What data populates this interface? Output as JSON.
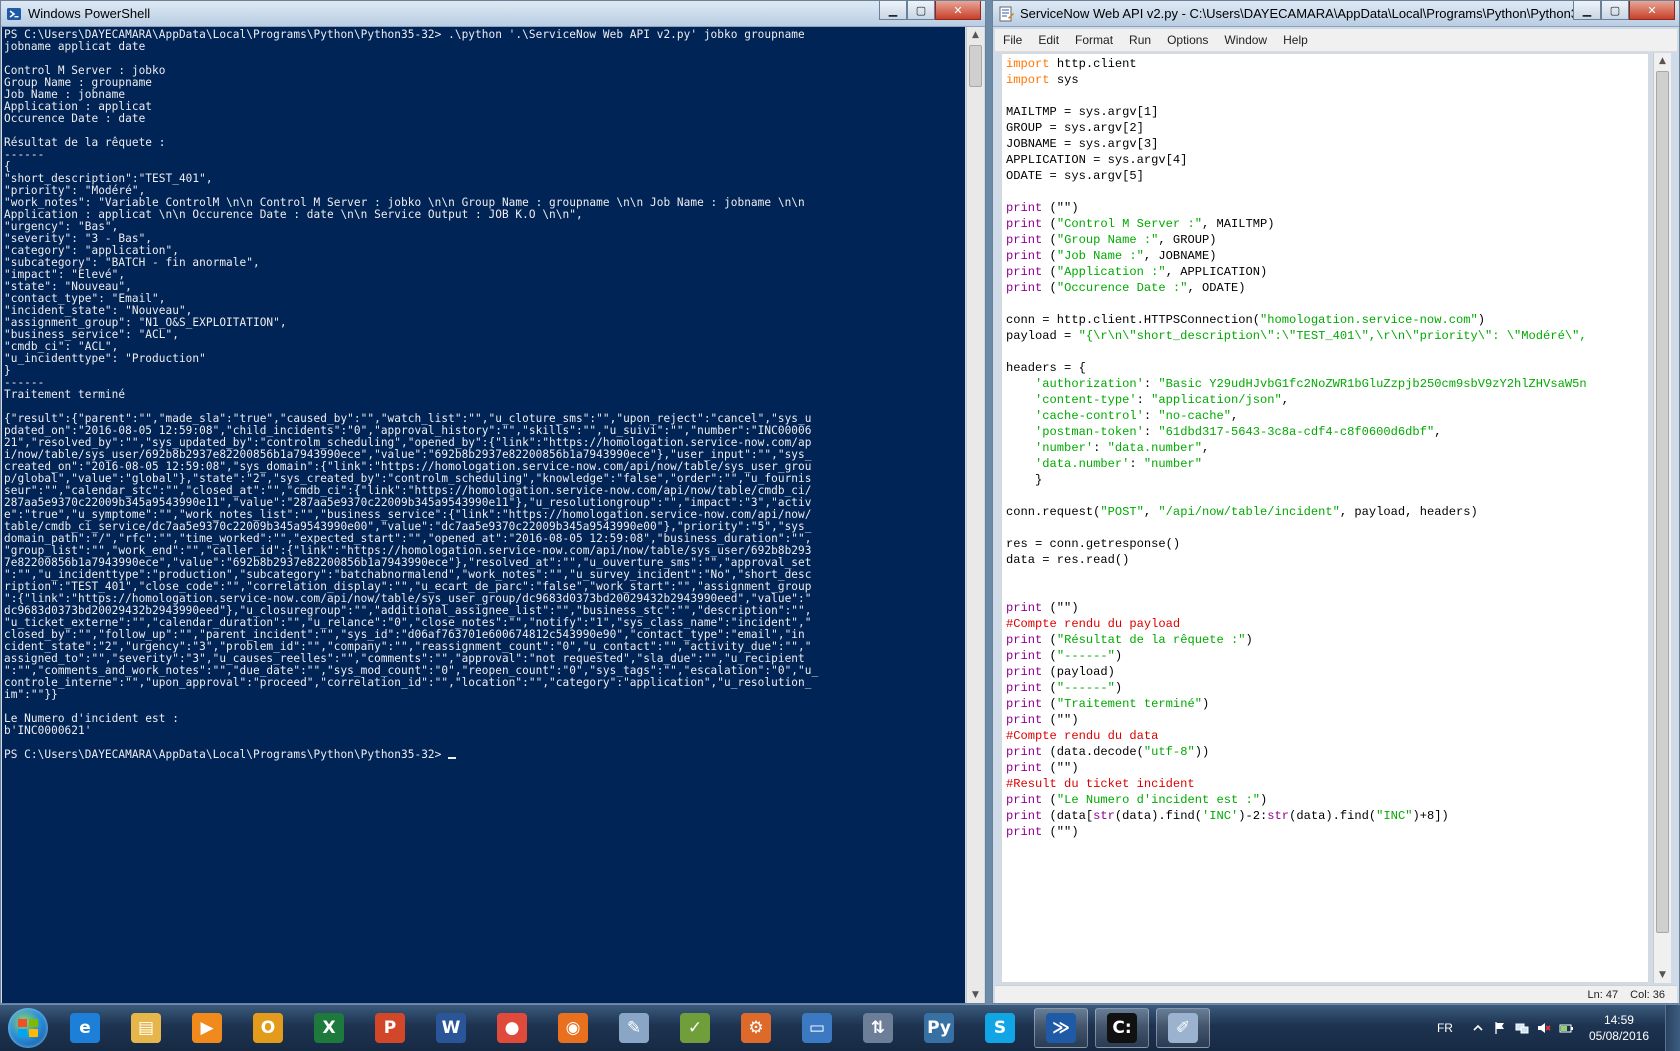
{
  "powershell": {
    "title": "Windows PowerShell",
    "output": "PS C:\\Users\\DAYECAMARA\\AppData\\Local\\Programs\\Python\\Python35-32> .\\python '.\\ServiceNow Web API v2.py' jobko groupname\njobname applicat date\n\nControl M Server : jobko\nGroup Name : groupname\nJob Name : jobname\nApplication : applicat\nOccurence Date : date\n\nRésultat de la rêquete :\n------\n{\n\"short_description\":\"TEST_401\",\n\"priority\": \"Modéré\",\n\"work_notes\": \"Variable ControlM \\n\\n Control M Server : jobko \\n\\n Group Name : groupname \\n\\n Job Name : jobname \\n\\n\nApplication : applicat \\n\\n Occurence Date : date \\n\\n Service Output : JOB K.O \\n\\n\",\n\"urgency\": \"Bas\",\n\"severity\": \"3 - Bas\",\n\"category\": \"application\",\n\"subcategory\": \"BATCH - fin anormale\",\n\"impact\": \"Elevé\",\n\"state\": \"Nouveau\",\n\"contact_type\": \"Email\",\n\"incident_state\": \"Nouveau\",\n\"assignment_group\": \"N1_O&S_EXPLOITATION\",\n\"business_service\": \"ACL\",\n\"cmdb_ci\": \"ACL\",\n\"u_incidenttype\": \"Production\"\n}\n------\nTraitement terminé\n\n{\"result\":{\"parent\":\"\",\"made_sla\":\"true\",\"caused_by\":\"\",\"watch_list\":\"\",\"u_cloture_sms\":\"\",\"upon_reject\":\"cancel\",\"sys_u\npdated_on\":\"2016-08-05 12:59:08\",\"child_incidents\":\"0\",\"approval_history\":\"\",\"skills\":\"\",\"u_suivi\":\"\",\"number\":\"INC00006\n21\",\"resolved_by\":\"\",\"sys_updated_by\":\"controlm_scheduling\",\"opened_by\":{\"link\":\"https://homologation.service-now.com/ap\ni/now/table/sys_user/692b8b2937e82200856b1a7943990ece\",\"value\":\"692b8b2937e82200856b1a7943990ece\"},\"user_input\":\"\",\"sys_\ncreated_on\":\"2016-08-05 12:59:08\",\"sys_domain\":{\"link\":\"https://homologation.service-now.com/api/now/table/sys_user_grou\np/global\",\"value\":\"global\"},\"state\":\"2\",\"sys_created_by\":\"controlm_scheduling\",\"knowledge\":\"false\",\"order\":\"\",\"u_fournis\nseur\":\"\",\"calendar_stc\":\"\",\"closed_at\":\"\",\"cmdb_ci\":{\"link\":\"https://homologation.service-now.com/api/now/table/cmdb_ci/\n287aa5e9370c22009b345a9543990e11\",\"value\":\"287aa5e9370c22009b345a9543990e11\"},\"u_resolutiongroup\":\"\",\"impact\":\"3\",\"activ\ne\":\"true\",\"u_symptome\":\"\",\"work_notes_list\":\"\",\"business_service\":{\"link\":\"https://homologation.service-now.com/api/now/\ntable/cmdb_ci_service/dc7aa5e9370c22009b345a9543990e00\",\"value\":\"dc7aa5e9370c22009b345a9543990e00\"},\"priority\":\"5\",\"sys_\ndomain_path\":\"/\",\"rfc\":\"\",\"time_worked\":\"\",\"expected_start\":\"\",\"opened_at\":\"2016-08-05 12:59:08\",\"business_duration\":\"\",\n\"group_list\":\"\",\"work_end\":\"\",\"caller_id\":{\"link\":\"https://homologation.service-now.com/api/now/table/sys_user/692b8b293\n7e82200856b1a7943990ece\",\"value\":\"692b8b2937e82200856b1a7943990ece\"},\"resolved_at\":\"\",\"u_ouverture_sms\":\"\",\"approval_set\n\":\"\",\"u_incidenttype\":\"production\",\"subcategory\":\"batchabnormalend\",\"work_notes\":\"\",\"u_survey_incident\":\"No\",\"short_desc\nription\":\"TEST_401\",\"close_code\":\"\",\"correlation_display\":\"\",\"u_ecart_de_parc\":\"false\",\"work_start\":\"\",\"assignment_group\n\":{\"link\":\"https://homologation.service-now.com/api/now/table/sys_user_group/dc9683d0373bd20029432b2943990eed\",\"value\":\"\ndc9683d0373bd20029432b2943990eed\"},\"u_closuregroup\":\"\",\"additional_assignee_list\":\"\",\"business_stc\":\"\",\"description\":\"\",\n\"u_ticket_externe\":\"\",\"calendar_duration\":\"\",\"u_relance\":\"0\",\"close_notes\":\"\",\"notify\":\"1\",\"sys_class_name\":\"incident\",\"\nclosed_by\":\"\",\"follow_up\":\"\",\"parent_incident\":\"\",\"sys_id\":\"d06af763701e600674812c543990e90\",\"contact_type\":\"email\",\"in\ncident_state\":\"2\",\"urgency\":\"3\",\"problem_id\":\"\",\"company\":\"\",\"reassignment_count\":\"0\",\"u_contact\":\"\",\"activity_due\":\"\",\"\nassigned_to\":\"\",\"severity\":\"3\",\"u_causes_reelles\":\"\",\"comments\":\"\",\"approval\":\"not requested\",\"sla_due\":\"\",\"u_recipient\n\":\"\",\"comments_and_work_notes\":\"\",\"due_date\":\"\",\"sys_mod_count\":\"0\",\"reopen_count\":\"0\",\"sys_tags\":\"\",\"escalation\":\"0\",\"u_\ncontrole_interne\":\"\",\"upon_approval\":\"proceed\",\"correlation_id\":\"\",\"location\":\"\",\"category\":\"application\",\"u_resolution_\nim\":\"\"}}\n\nLe Numero d'incident est :\nb'INC0000621'\n\n",
    "prompt": "PS C:\\Users\\DAYECAMARA\\AppData\\Local\\Programs\\Python\\Python35-32> "
  },
  "idle": {
    "title": "ServiceNow Web API v2.py - C:\\Users\\DAYECAMARA\\AppData\\Local\\Programs\\Python\\Python35-32...",
    "menu": [
      "File",
      "Edit",
      "Format",
      "Run",
      "Options",
      "Window",
      "Help"
    ],
    "code_lines": [
      [
        [
          "kw",
          "import"
        ],
        [
          "",
          "http.client"
        ]
      ],
      [
        [
          "kw",
          "import"
        ],
        [
          "",
          "sys"
        ]
      ],
      [],
      [
        [
          "",
          "MAILTMP = sys.argv[1]"
        ]
      ],
      [
        [
          "",
          "GROUP = sys.argv[2]"
        ]
      ],
      [
        [
          "",
          "JOBNAME = sys.argv[3]"
        ]
      ],
      [
        [
          "",
          "APPLICATION = sys.argv[4]"
        ]
      ],
      [
        [
          "",
          "ODATE = sys.argv[5]"
        ]
      ],
      [],
      [
        [
          "bi",
          "print"
        ],
        [
          "",
          "(\"\")"
        ]
      ],
      [
        [
          "bi",
          "print"
        ],
        [
          "",
          "("
        ],
        [
          "st",
          "\"Control M Server :\""
        ],
        [
          "",
          ", MAILTMP)"
        ]
      ],
      [
        [
          "bi",
          "print"
        ],
        [
          "",
          "("
        ],
        [
          "st",
          "\"Group Name :\""
        ],
        [
          "",
          ", GROUP)"
        ]
      ],
      [
        [
          "bi",
          "print"
        ],
        [
          "",
          "("
        ],
        [
          "st",
          "\"Job Name :\""
        ],
        [
          "",
          ", JOBNAME)"
        ]
      ],
      [
        [
          "bi",
          "print"
        ],
        [
          "",
          "("
        ],
        [
          "st",
          "\"Application :\""
        ],
        [
          "",
          ", APPLICATION)"
        ]
      ],
      [
        [
          "bi",
          "print"
        ],
        [
          "",
          "("
        ],
        [
          "st",
          "\"Occurence Date :\""
        ],
        [
          "",
          ", ODATE)"
        ]
      ],
      [],
      [
        [
          "",
          "conn = http.client.HTTPSConnection("
        ],
        [
          "st",
          "\"homologation.service-now.com\""
        ],
        [
          "",
          ")"
        ]
      ],
      [
        [
          "",
          "payload = "
        ],
        [
          "st",
          "\"{\\r\\n\\\"short_description\\\":\\\"TEST_401\\\",\\r\\n\\\"priority\\\": \\\"Modéré\\\","
        ]
      ],
      [],
      [
        [
          "",
          "headers = {"
        ]
      ],
      [
        [
          "",
          "    "
        ],
        [
          "st",
          "'authorization'"
        ],
        [
          "",
          ": "
        ],
        [
          "st",
          "\"Basic Y29udHJvbG1fc2NoZWR1bGluZzpjb250cm9sbV9zY2hlZHVsaW5n"
        ]
      ],
      [
        [
          "",
          "    "
        ],
        [
          "st",
          "'content-type'"
        ],
        [
          "",
          ": "
        ],
        [
          "st",
          "\"application/json\""
        ],
        [
          "",
          ","
        ]
      ],
      [
        [
          "",
          "    "
        ],
        [
          "st",
          "'cache-control'"
        ],
        [
          "",
          ": "
        ],
        [
          "st",
          "\"no-cache\""
        ],
        [
          "",
          ","
        ]
      ],
      [
        [
          "",
          "    "
        ],
        [
          "st",
          "'postman-token'"
        ],
        [
          "",
          ": "
        ],
        [
          "st",
          "\"61dbd317-5643-3c8a-cdf4-c8f0600d6dbf\""
        ],
        [
          "",
          ","
        ]
      ],
      [
        [
          "",
          "    "
        ],
        [
          "st",
          "'number'"
        ],
        [
          "",
          ": "
        ],
        [
          "st",
          "\"data.number\""
        ],
        [
          "",
          ","
        ]
      ],
      [
        [
          "",
          "    "
        ],
        [
          "st",
          "'data.number'"
        ],
        [
          "",
          ": "
        ],
        [
          "st",
          "\"number\""
        ]
      ],
      [
        [
          "",
          "    }"
        ]
      ],
      [],
      [
        [
          "",
          "conn.request("
        ],
        [
          "st",
          "\"POST\""
        ],
        [
          "",
          ", "
        ],
        [
          "st",
          "\"/api/now/table/incident\""
        ],
        [
          "",
          ", payload, headers)"
        ]
      ],
      [],
      [
        [
          "",
          "res = conn.getresponse()"
        ]
      ],
      [
        [
          "",
          "data = res.read()"
        ]
      ],
      [],
      [],
      [
        [
          "bi",
          "print"
        ],
        [
          "",
          "(\"\")"
        ]
      ],
      [
        [
          "cm",
          "#Compte rendu du payload"
        ]
      ],
      [
        [
          "bi",
          "print"
        ],
        [
          "",
          "("
        ],
        [
          "st",
          "\"Résultat de la rêquete :\""
        ],
        [
          "",
          ")"
        ]
      ],
      [
        [
          "bi",
          "print"
        ],
        [
          "",
          "("
        ],
        [
          "st",
          "\"------\""
        ],
        [
          "",
          ")"
        ]
      ],
      [
        [
          "bi",
          "print"
        ],
        [
          "",
          "(payload)"
        ]
      ],
      [
        [
          "bi",
          "print"
        ],
        [
          "",
          "("
        ],
        [
          "st",
          "\"------\""
        ],
        [
          "",
          ")"
        ]
      ],
      [
        [
          "bi",
          "print"
        ],
        [
          "",
          "("
        ],
        [
          "st",
          "\"Traitement terminé\""
        ],
        [
          "",
          ")"
        ]
      ],
      [
        [
          "bi",
          "print"
        ],
        [
          "",
          "(\"\")"
        ]
      ],
      [
        [
          "cm",
          "#Compte rendu du data"
        ]
      ],
      [
        [
          "bi",
          "print"
        ],
        [
          "",
          "(data.decode("
        ],
        [
          "st",
          "\"utf-8\""
        ],
        [
          "",
          "))"
        ]
      ],
      [
        [
          "bi",
          "print"
        ],
        [
          "",
          "(\"\")"
        ]
      ],
      [
        [
          "cm",
          "#Result du ticket incident"
        ]
      ],
      [
        [
          "bi",
          "print"
        ],
        [
          "",
          "("
        ],
        [
          "st",
          "\"Le Numero d'incident est :\""
        ],
        [
          "",
          ")"
        ]
      ],
      [
        [
          "bi",
          "print"
        ],
        [
          "",
          "(data["
        ],
        [
          "bi",
          "str"
        ],
        [
          "",
          "(data).find("
        ],
        [
          "st",
          "'INC'"
        ],
        [
          "",
          ")-2:"
        ],
        [
          "bi",
          "str"
        ],
        [
          "",
          "(data).find("
        ],
        [
          "st",
          "\"INC\""
        ],
        [
          "",
          ")+8])"
        ]
      ],
      [
        [
          "bi",
          "print"
        ],
        [
          "",
          "(\"\")"
        ]
      ]
    ],
    "status_line": "Ln: 47",
    "status_col": "Col: 36"
  },
  "taskbar": {
    "apps": [
      {
        "name": "internet-explorer",
        "letter": "e",
        "color": "#1e7fd8",
        "active": false
      },
      {
        "name": "windows-explorer",
        "letter": "▤",
        "color": "#e7b64a",
        "active": false
      },
      {
        "name": "media-player",
        "letter": "▶",
        "color": "#f08a1c",
        "active": false
      },
      {
        "name": "outlook",
        "letter": "O",
        "color": "#e39b1b",
        "active": false
      },
      {
        "name": "excel",
        "letter": "X",
        "color": "#1d7a3c",
        "active": false
      },
      {
        "name": "powerpoint",
        "letter": "P",
        "color": "#d2472a",
        "active": false
      },
      {
        "name": "word",
        "letter": "W",
        "color": "#2a5699",
        "active": false
      },
      {
        "name": "chrome",
        "letter": "●",
        "color": "#e04a3a",
        "active": false
      },
      {
        "name": "firefox",
        "letter": "◉",
        "color": "#e8701e",
        "active": false
      },
      {
        "name": "paint",
        "letter": "✎",
        "color": "#8aa6c6",
        "active": false
      },
      {
        "name": "notepad-chart",
        "letter": "✓",
        "color": "#6f9e3a",
        "active": false
      },
      {
        "name": "tool",
        "letter": "⚙",
        "color": "#dd6a2a",
        "active": false
      },
      {
        "name": "remote-desktop",
        "letter": "▭",
        "color": "#3b7ac2",
        "active": false
      },
      {
        "name": "network",
        "letter": "⇅",
        "color": "#6d7f98",
        "active": false
      },
      {
        "name": "python",
        "letter": "Py",
        "color": "#3771a4",
        "active": false
      },
      {
        "name": "skype",
        "letter": "S",
        "color": "#12a5e6",
        "active": false
      },
      {
        "name": "powershell",
        "letter": "≫",
        "color": "#1f5aa6",
        "active": true
      },
      {
        "name": "cmd",
        "letter": "C:",
        "color": "#111111",
        "active": true
      },
      {
        "name": "idle-editor",
        "letter": "✐",
        "color": "#9bb3cf",
        "active": true
      }
    ],
    "language": "FR",
    "time": "14:59",
    "date": "05/08/2016"
  }
}
